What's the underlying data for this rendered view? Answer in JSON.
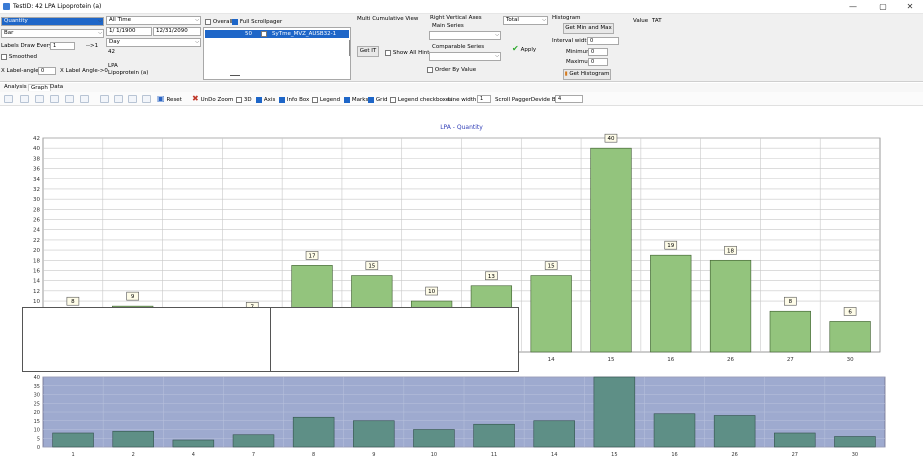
{
  "window": {
    "title": "TestID: 42  LPA Lipoprotein (a)",
    "min_glyph": "—",
    "max_glyph": "▢",
    "close_glyph": "✕"
  },
  "controls": {
    "measure_combo": "Quantity",
    "chart_type_combo": "Bar",
    "labels_draw_every_label": "Labels Draw Every",
    "labels_draw_every_value": "1",
    "labels_draw_arrow": "-->1",
    "smoothed_label": "Smoothed",
    "x_label_angle_label": "X Label-angle",
    "x_label_angle_value": "0",
    "x_label_angle_readout": "X Label Angle->0",
    "period_combo": "All Time",
    "date_from": "1/ 1/1900",
    "date_to": "12/31/2090",
    "granularity_combo": "Day",
    "test_id": "42",
    "test_code": "LPA",
    "test_name": "Lipoprotein (a)",
    "overall_label": "Overall",
    "full_scrollpager_label": "Full Scrollpager",
    "series_count": "50",
    "series_name": "SyTme_MVZ_AUSB32-1",
    "multi_cumulative_label": "Multi Cumulative View",
    "get_it_button": "Get IT",
    "show_all_hint_label": "Show All Hint",
    "right_vertical_axes_label": "Right Vertical Axes",
    "main_series_label": "Main Series",
    "comparable_series_label": "Comparable Series",
    "order_by_value_label": "Order By Value",
    "total_combo": "Total",
    "apply_button": "Apply",
    "histogram_label": "Histogram",
    "get_min_max_button": "Get Min and Max",
    "interval_width_label": "Interval width",
    "interval_width_value": "0",
    "minimum_label": "Minimum",
    "minimum_value": "0",
    "maximum_label": "Maximum",
    "maximum_value": "0",
    "get_histogram_button": "Get Histogram",
    "value_label": "Value",
    "tat_label": "TAT"
  },
  "tabs": [
    "Analysis",
    "Graph",
    "Data"
  ],
  "chart_toolbar": {
    "reset_label": "Reset",
    "undo_zoom_label": "UnDo Zoom",
    "3d_label": "3D",
    "axis_label": "Axis",
    "info_box_label": "Info Box",
    "legend_label": "Legend",
    "marks_label": "Marks",
    "grid_label": "Grid",
    "legend_checkboxes_label": "Legend checkboxes",
    "line_width_label": "Line width",
    "line_width_value": "1",
    "scroll_pager_divide_label": "Scroll PaggerDevide By",
    "scroll_pager_divide_value": "4"
  },
  "chart_data": {
    "type": "bar",
    "title": "LPA - Quantity",
    "categories": [
      "1",
      "2",
      "4",
      "7",
      "8",
      "9",
      "10",
      "11",
      "14",
      "15",
      "16",
      "26",
      "27",
      "30"
    ],
    "values": [
      8,
      9,
      4,
      7,
      17,
      15,
      10,
      13,
      15,
      40,
      19,
      18,
      8,
      6
    ],
    "ylim": [
      0,
      42
    ],
    "yticks": [
      10,
      12,
      14,
      16,
      18,
      20,
      22,
      24,
      26,
      28,
      30,
      32,
      34,
      36,
      38,
      40,
      42
    ],
    "grid": true,
    "bar_color": "#93c47d",
    "navigator": {
      "ylim": [
        0,
        40
      ],
      "yticks": [
        0,
        5,
        10,
        15,
        20,
        25,
        30,
        35,
        40
      ],
      "bar_color": "#5e8f86",
      "background": "#9eaacf"
    }
  }
}
